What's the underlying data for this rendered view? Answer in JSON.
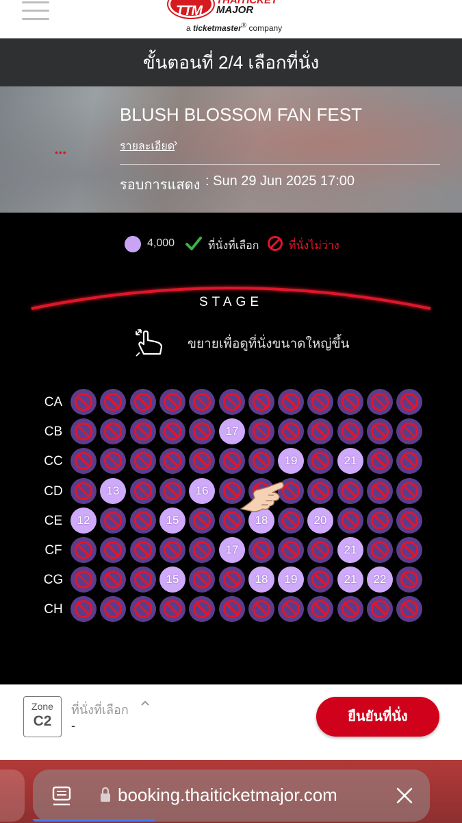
{
  "header": {
    "logo_mark": "TTM",
    "logo_line1": "THAITICKET",
    "logo_line2": "MAJOR",
    "logo_sub_prefix": "a",
    "logo_sub_brand": "ticketmaster",
    "logo_sub_suffix": "company"
  },
  "step": {
    "title": "ขั้นตอนที่ 2/4 เลือกที่นั่ง"
  },
  "event": {
    "title": "BLUSH BLOSSOM FAN FEST",
    "detail_link": "รายละเอียด",
    "round_label": "รอบการแสดง",
    "round_value": ": Sun 29 Jun 2025 17:00",
    "dots": "•••"
  },
  "legend": {
    "price": "4,000",
    "selected_label": "ที่นั่งที่เลือก",
    "unavailable_label": "ที่นั่งไม่ว่าง",
    "price_color": "#c9a4f4",
    "unavailable_color": "#e0162b"
  },
  "stage": {
    "label": "STAGE"
  },
  "zoom_hint": {
    "text": "ขยายเพื่อดูที่นั่งขนาดใหญ่ขึ้น",
    "icon": "pinch-zoom-icon"
  },
  "seatmap": {
    "seats_per_row": 12,
    "rows": [
      {
        "label": "CA",
        "seats": [
          null,
          null,
          null,
          null,
          null,
          null,
          null,
          null,
          null,
          null,
          null,
          null
        ]
      },
      {
        "label": "CB",
        "seats": [
          null,
          null,
          null,
          null,
          null,
          "17",
          null,
          null,
          null,
          null,
          null,
          null
        ]
      },
      {
        "label": "CC",
        "seats": [
          null,
          null,
          null,
          null,
          null,
          null,
          null,
          "19",
          null,
          "21",
          null,
          null
        ]
      },
      {
        "label": "CD",
        "seats": [
          null,
          "13",
          null,
          null,
          "16",
          null,
          null,
          null,
          null,
          null,
          null,
          null
        ]
      },
      {
        "label": "CE",
        "seats": [
          "12",
          null,
          null,
          "15",
          null,
          null,
          "18",
          null,
          "20",
          null,
          null,
          null
        ]
      },
      {
        "label": "CF",
        "seats": [
          null,
          null,
          null,
          null,
          null,
          "17",
          null,
          null,
          null,
          "21",
          null,
          null
        ]
      },
      {
        "label": "CG",
        "seats": [
          null,
          null,
          null,
          "15",
          null,
          null,
          "18",
          "19",
          null,
          "21",
          "22",
          null
        ]
      },
      {
        "label": "CH",
        "seats": [
          null,
          null,
          null,
          null,
          null,
          null,
          null,
          null,
          null,
          null,
          null,
          null
        ]
      }
    ]
  },
  "bottom": {
    "zone_label": "Zone",
    "zone_code": "C2",
    "selected_label": "ที่นั่งที่เลือก",
    "selected_value": "-",
    "confirm_label": "ยืนยันที่นั่ง",
    "confirm_color": "#d0021b"
  },
  "browser": {
    "url": "booking.thaiticketmajor.com"
  }
}
